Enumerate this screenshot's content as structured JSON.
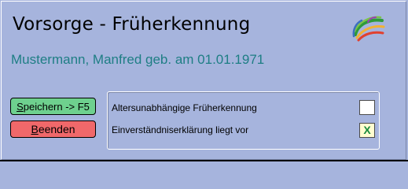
{
  "header": {
    "title": "Vorsorge - Früherkennung",
    "patient_line": "Mustermann, Manfred geb. am 01.01.1971"
  },
  "buttons": {
    "save_label": "Speichern -> F5",
    "end_label": "Beenden"
  },
  "options": [
    {
      "label": "Altersunabhängige Früherkennung",
      "checked": false,
      "mark": ""
    },
    {
      "label": "Einverständniserklärung liegt vor",
      "checked": true,
      "mark": "X"
    }
  ],
  "colors": {
    "background": "#a6b4dd",
    "patient_text": "#1e7e84",
    "save_button": "#6ed08e",
    "end_button": "#f0686a",
    "checkmark": "#178a3c"
  },
  "icons": {
    "logo": "colorful-swoosh-logo-icon"
  }
}
